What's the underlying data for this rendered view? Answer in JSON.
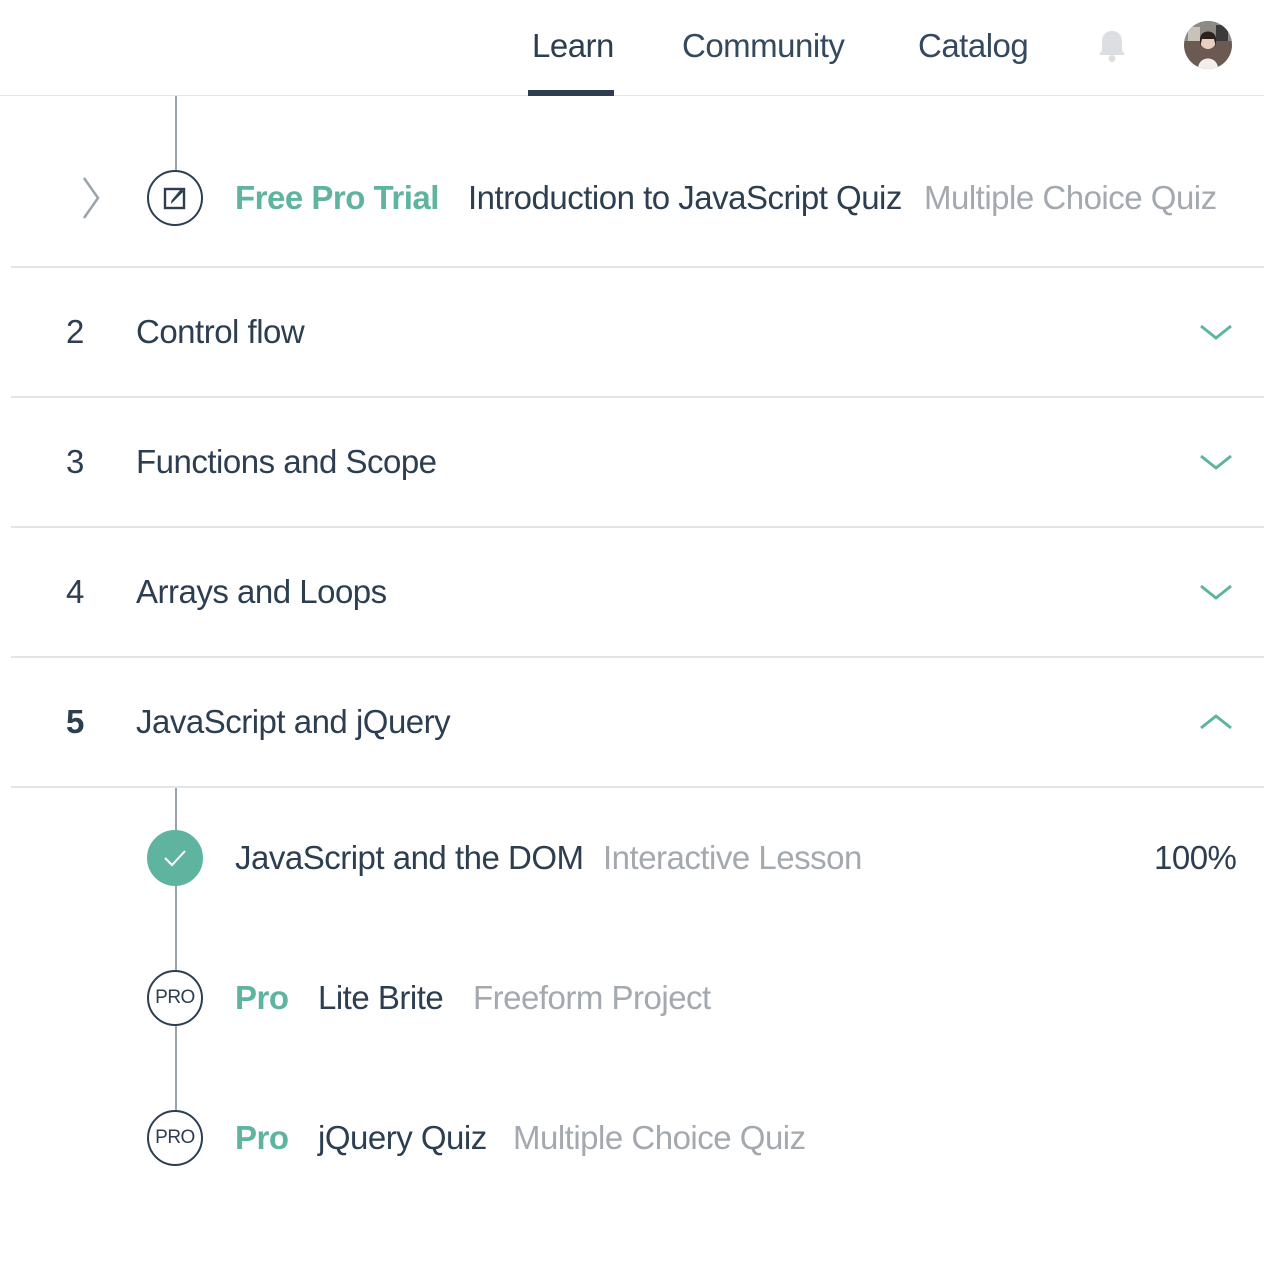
{
  "nav": {
    "learn": "Learn",
    "community": "Community",
    "catalog": "Catalog"
  },
  "icons": {
    "bell": "bell-icon",
    "avatar": "avatar",
    "chevron_down": "chevron-down-icon",
    "chevron_up": "chevron-up-icon",
    "chevron_right": "chevron-right-icon",
    "quiz": "pencil-square-icon",
    "check": "checkmark-icon"
  },
  "colors": {
    "accent": "#5fb4a0",
    "primary_text": "#2c3e50",
    "muted_text": "#a3a9ae",
    "divider": "#e2e4e6"
  },
  "stage1_quiz": {
    "badge": "Free Pro Trial",
    "title": "Introduction to JavaScript Quiz",
    "type": "Multiple Choice Quiz"
  },
  "stages": [
    {
      "number": "2",
      "title": "Control flow",
      "expanded": false
    },
    {
      "number": "3",
      "title": "Functions and Scope",
      "expanded": false
    },
    {
      "number": "4",
      "title": "Arrays and Loops",
      "expanded": false
    },
    {
      "number": "5",
      "title": "JavaScript and jQuery",
      "expanded": true
    }
  ],
  "stage5_steps": [
    {
      "status": "complete",
      "title": "JavaScript and the DOM",
      "type": "Interactive Lesson",
      "progress": "100%"
    },
    {
      "status": "pro",
      "circle_label": "PRO",
      "badge": "Pro",
      "title": "Lite Brite",
      "type": "Freeform Project"
    },
    {
      "status": "pro",
      "circle_label": "PRO",
      "badge": "Pro",
      "title": "jQuery Quiz",
      "type": "Multiple Choice Quiz"
    }
  ]
}
